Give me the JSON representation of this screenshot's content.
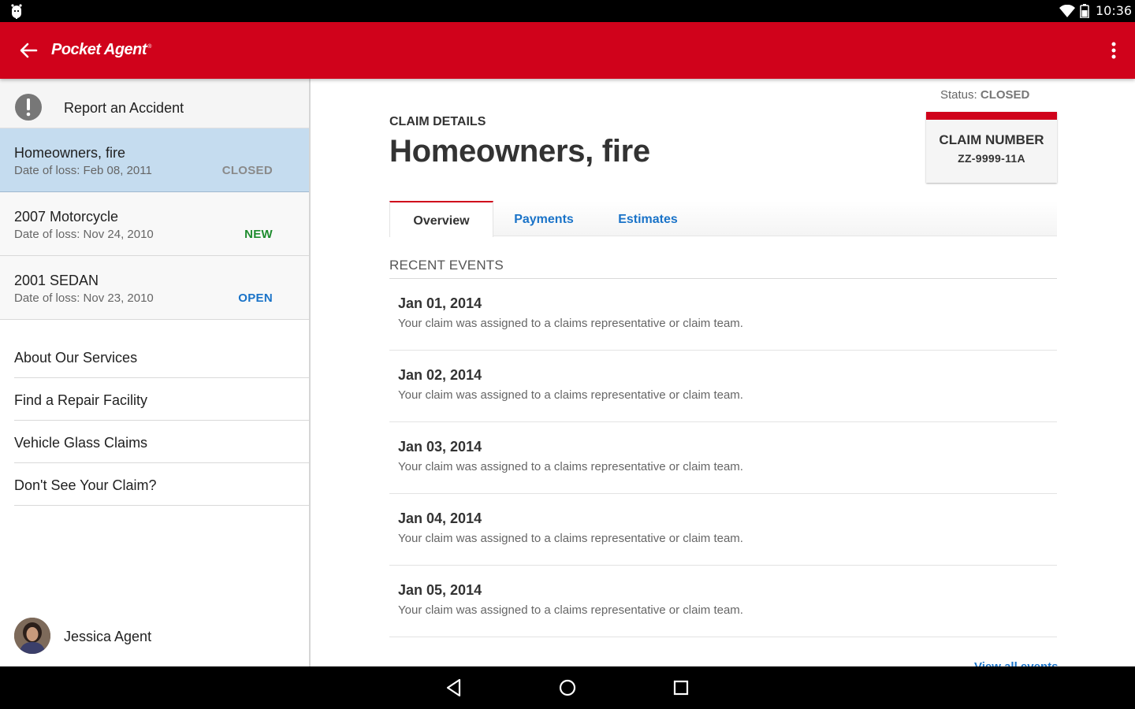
{
  "status_bar": {
    "time": "10:36"
  },
  "app_bar": {
    "title": "Pocket Agent",
    "trademark": "®"
  },
  "sidebar": {
    "report": {
      "label": "Report an Accident"
    },
    "claims": [
      {
        "name": "Homeowners, fire",
        "date_of_loss": "Date of loss: Feb 08, 2011",
        "status": "CLOSED",
        "status_color": "#8a8a8a",
        "selected": true
      },
      {
        "name": "2007 Motorcycle",
        "date_of_loss": "Date of loss: Nov 24, 2010",
        "status": "NEW",
        "status_color": "#1e8c2e",
        "selected": false
      },
      {
        "name": "2001 SEDAN",
        "date_of_loss": "Date of loss: Nov 23, 2010",
        "status": "OPEN",
        "status_color": "#1a73c8",
        "selected": false
      }
    ],
    "menu": [
      {
        "label": "About Our Services"
      },
      {
        "label": "Find a Repair Facility"
      },
      {
        "label": "Vehicle Glass Claims"
      },
      {
        "label": "Don't See Your Claim?"
      }
    ],
    "user": {
      "name": "Jessica Agent"
    }
  },
  "main": {
    "status_label": "Status:",
    "status_value": "CLOSED",
    "claim_number_label": "CLAIM NUMBER",
    "claim_number": "ZZ-9999-11A",
    "section_caption": "CLAIM DETAILS",
    "title": "Homeowners, fire",
    "tabs": [
      {
        "label": "Overview",
        "active": true
      },
      {
        "label": "Payments",
        "active": false
      },
      {
        "label": "Estimates",
        "active": false
      }
    ],
    "events_caption": "RECENT EVENTS",
    "events": [
      {
        "date": "Jan 01, 2014",
        "description": "Your claim was assigned to a claims representative or claim team."
      },
      {
        "date": "Jan 02, 2014",
        "description": "Your claim was assigned to a claims representative or claim team."
      },
      {
        "date": "Jan 03, 2014",
        "description": "Your claim was assigned to a claims representative or claim team."
      },
      {
        "date": "Jan 04, 2014",
        "description": "Your claim was assigned to a claims representative or claim team."
      },
      {
        "date": "Jan 05, 2014",
        "description": "Your claim was assigned to a claims representative or claim team."
      }
    ],
    "view_all_label": "View all events"
  },
  "colors": {
    "brand_red": "#d0021b",
    "link_blue": "#1a73c8",
    "selected_bg": "#c5dcef"
  },
  "icons": [
    "android-icon",
    "wifi-icon",
    "battery-icon",
    "back-arrow-icon",
    "overflow-menu-icon",
    "alert-icon",
    "nav-back-icon",
    "nav-home-icon",
    "nav-recents-icon"
  ]
}
